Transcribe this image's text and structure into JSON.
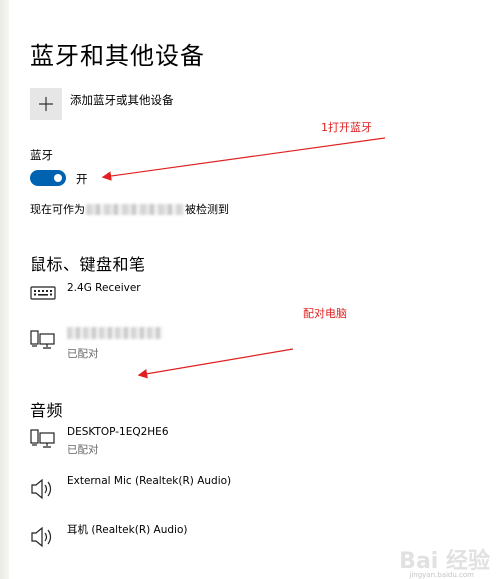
{
  "page": {
    "title": "蓝牙和其他设备"
  },
  "add_device": {
    "label": "添加蓝牙或其他设备",
    "icon": "plus-icon"
  },
  "bluetooth": {
    "label": "蓝牙",
    "state": "开",
    "on": true,
    "discover_prefix": "现在可作为",
    "discover_suffix": "被检测到",
    "accent": "#0063b1"
  },
  "sections": {
    "mouse_keyboard": {
      "title": "鼠标、键盘和笔",
      "devices": [
        {
          "name": "2.4G Receiver",
          "icon": "keyboard-icon"
        },
        {
          "status": "已配对",
          "icon": "computer-icon"
        }
      ]
    },
    "audio": {
      "title": "音频",
      "devices": [
        {
          "name": "DESKTOP-1EQ2HE6",
          "status": "已配对",
          "icon": "computer-icon"
        },
        {
          "name": "External Mic (Realtek(R) Audio)",
          "icon": "speaker-icon"
        },
        {
          "name": "耳机 (Realtek(R) Audio)",
          "icon": "speaker-icon"
        }
      ]
    }
  },
  "annotations": {
    "a1": "1打开蓝牙",
    "a2": "配对电脑",
    "color": "#e02020"
  },
  "watermark": {
    "text": "Bai 经验",
    "url": "jingyan.baidu.com"
  }
}
